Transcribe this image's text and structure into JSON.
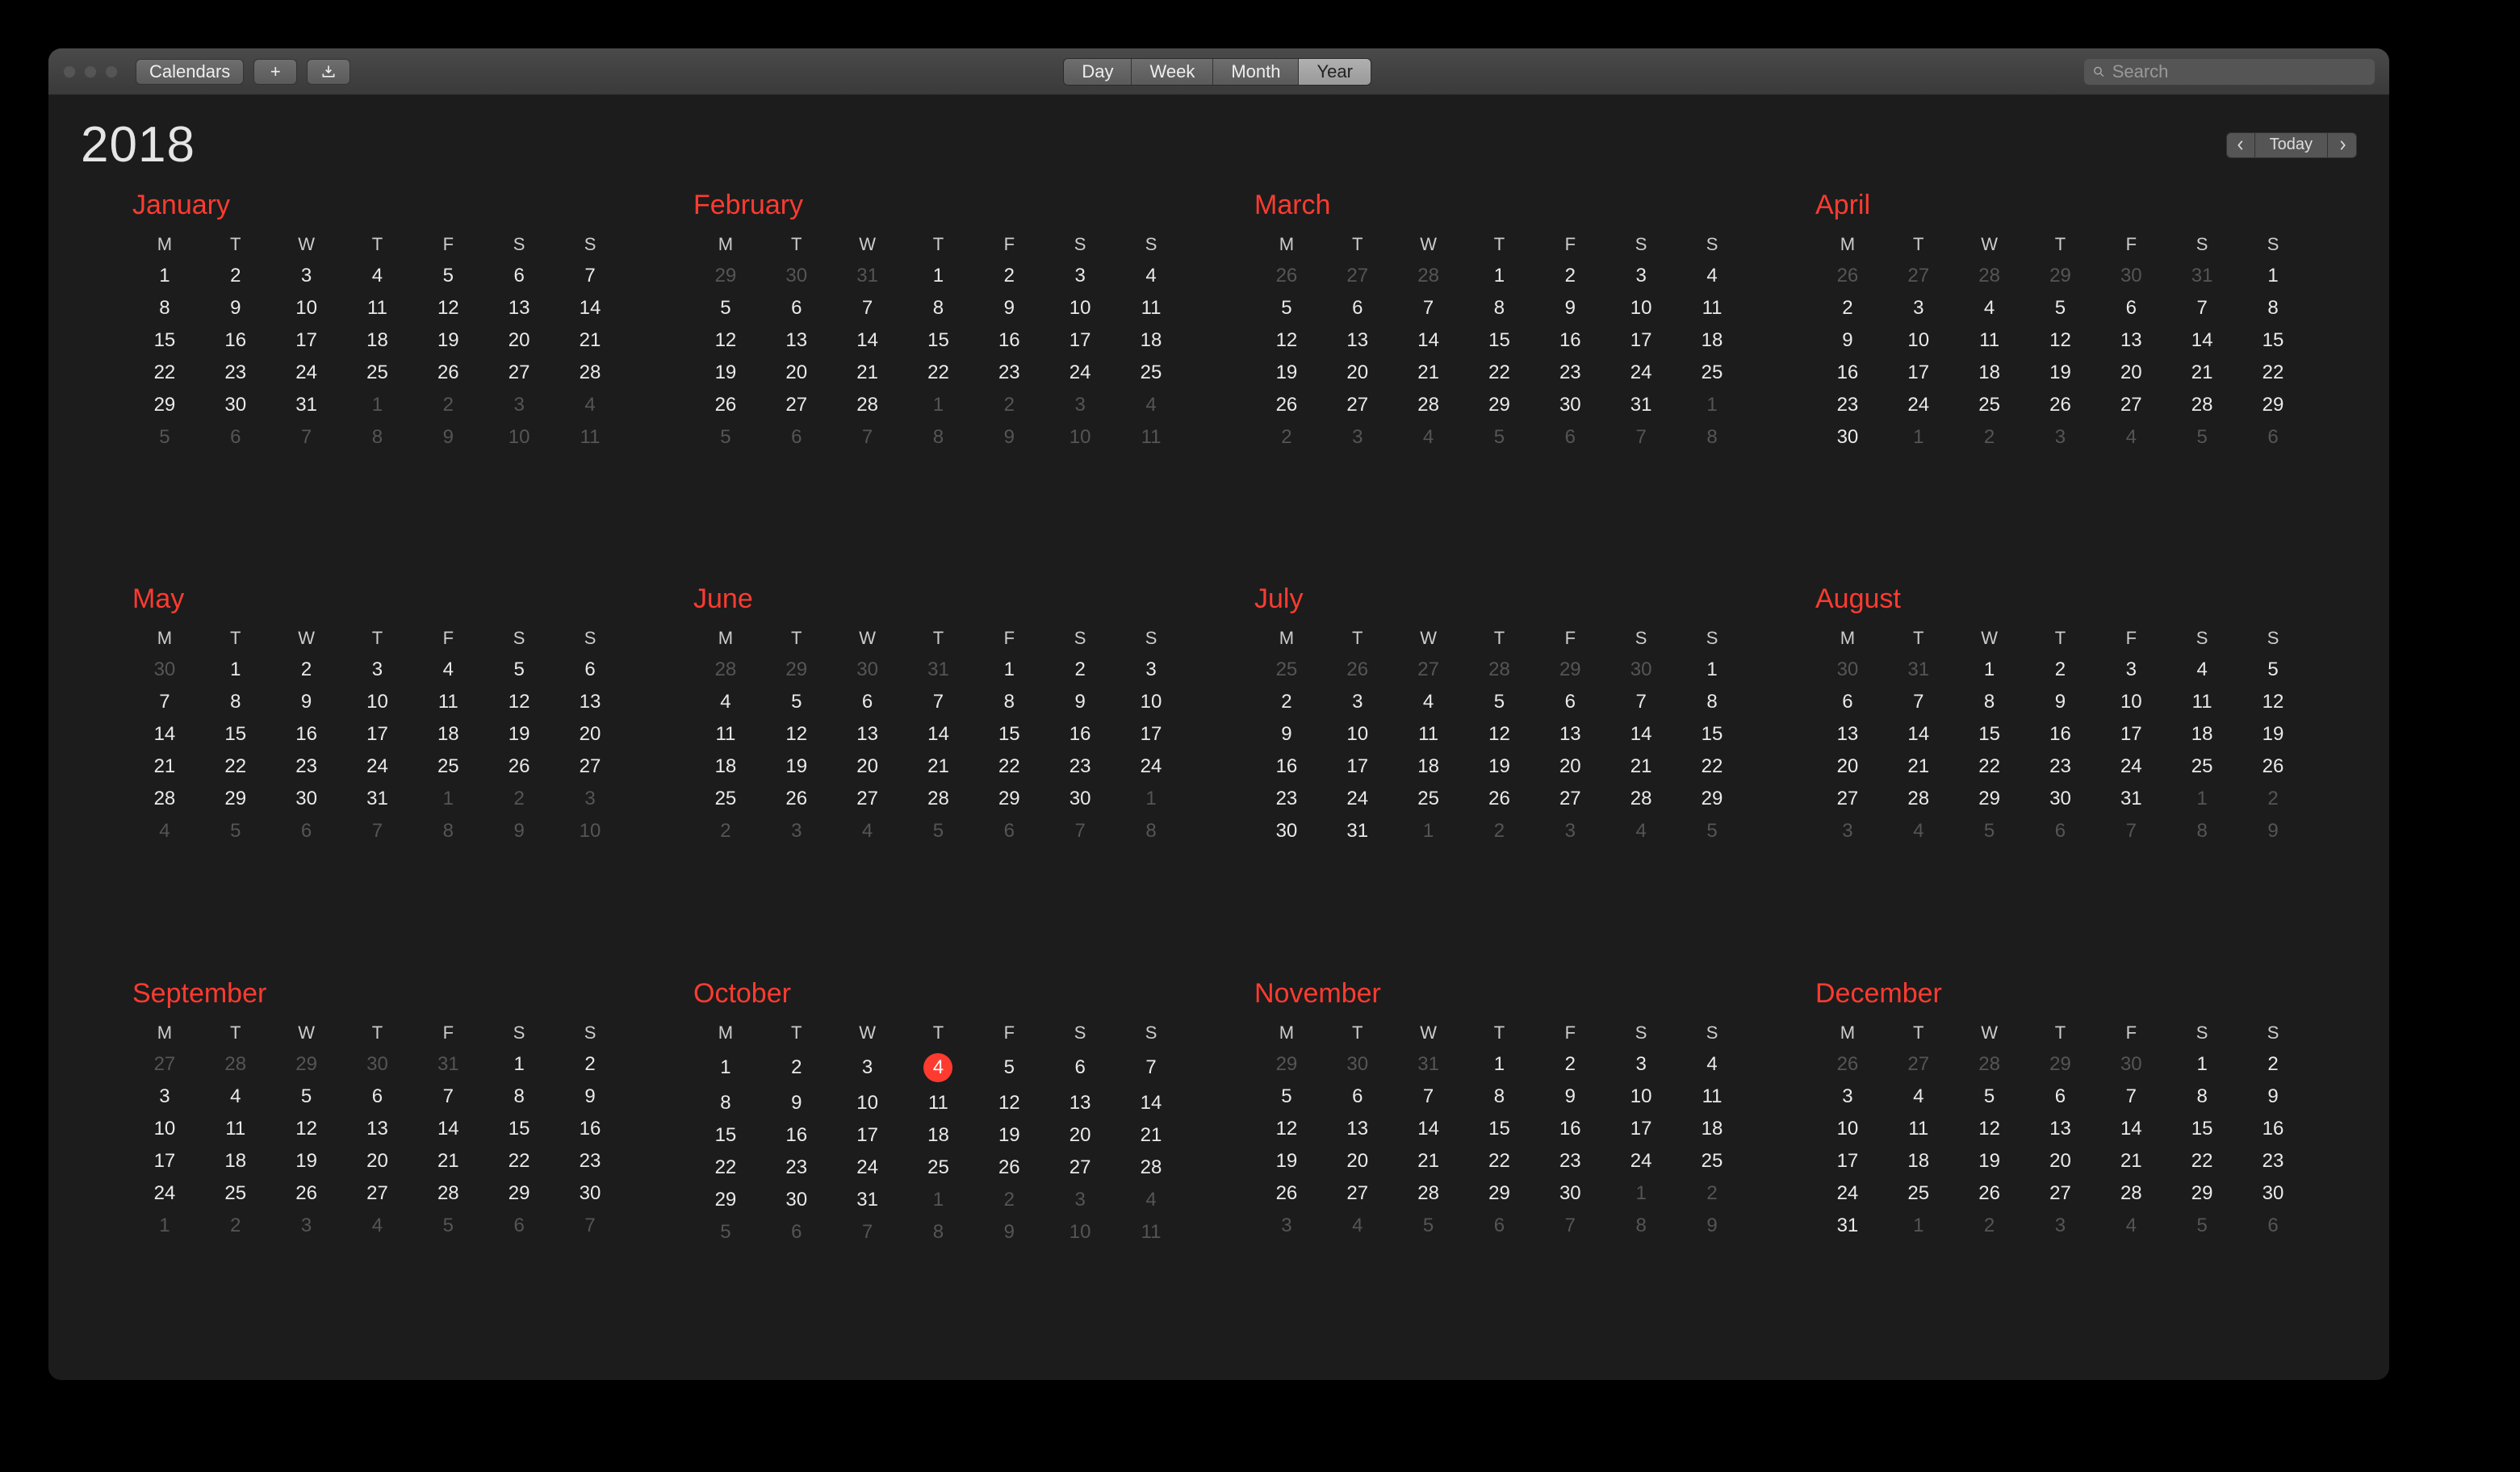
{
  "toolbar": {
    "calendars_label": "Calendars",
    "view_modes": [
      "Day",
      "Week",
      "Month",
      "Year"
    ],
    "active_view": "Year",
    "search_placeholder": "Search",
    "today_label": "Today"
  },
  "year": "2018",
  "dow": [
    "M",
    "T",
    "W",
    "T",
    "F",
    "S",
    "S"
  ],
  "today": {
    "month": 9,
    "day": 4
  },
  "months": [
    {
      "name": "January",
      "lead": [],
      "days": 31,
      "trail_start": 1
    },
    {
      "name": "February",
      "lead": [
        29,
        30,
        31
      ],
      "days": 28,
      "trail_start": 1
    },
    {
      "name": "March",
      "lead": [
        26,
        27,
        28
      ],
      "days": 31,
      "trail_start": 1
    },
    {
      "name": "April",
      "lead": [
        26,
        27,
        28,
        29,
        30,
        31
      ],
      "days": 30,
      "trail_start": 1
    },
    {
      "name": "May",
      "lead": [
        30
      ],
      "days": 31,
      "trail_start": 1
    },
    {
      "name": "June",
      "lead": [
        28,
        29,
        30,
        31
      ],
      "days": 30,
      "trail_start": 1
    },
    {
      "name": "July",
      "lead": [
        25,
        26,
        27,
        28,
        29,
        30
      ],
      "days": 31,
      "trail_start": 1
    },
    {
      "name": "August",
      "lead": [
        30,
        31
      ],
      "days": 31,
      "trail_start": 1
    },
    {
      "name": "September",
      "lead": [
        27,
        28,
        29,
        30,
        31
      ],
      "days": 30,
      "trail_start": 1
    },
    {
      "name": "October",
      "lead": [],
      "days": 31,
      "trail_start": 1
    },
    {
      "name": "November",
      "lead": [
        29,
        30,
        31
      ],
      "days": 30,
      "trail_start": 1
    },
    {
      "name": "December",
      "lead": [
        26,
        27,
        28,
        29,
        30
      ],
      "days": 31,
      "trail_start": 1
    }
  ]
}
